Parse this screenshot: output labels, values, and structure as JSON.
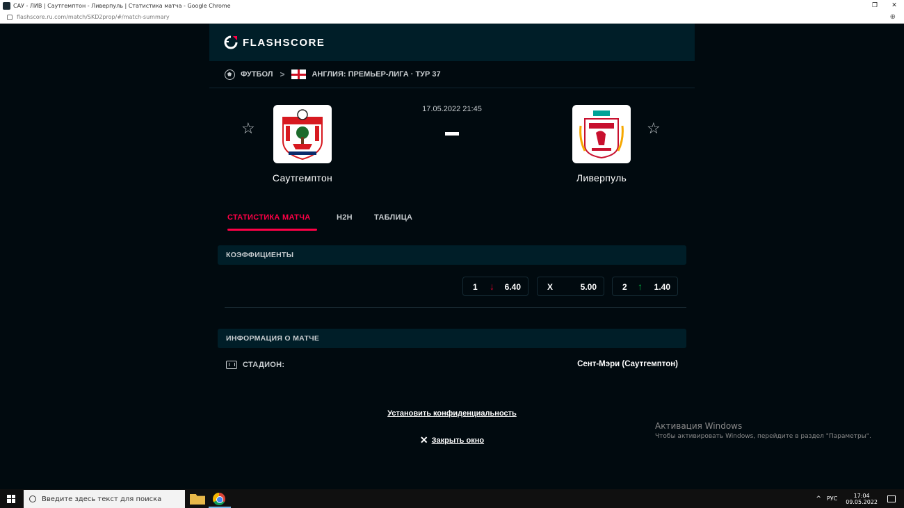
{
  "window": {
    "title": "САУ - ЛИВ | Саутгемптон - Ливерпуль | Статистика матча - Google Chrome",
    "url": "flashscore.ru.com/match/SKD2prop/#/match-summary",
    "zoom_icon": "zoom-icon"
  },
  "header": {
    "logo_text": "FLASHSCORE"
  },
  "breadcrumb": {
    "sport": "ФУТБОЛ",
    "separator": ">",
    "league": "АНГЛИЯ: ПРЕМЬЕР-ЛИГА · ТУР 37"
  },
  "match": {
    "home": {
      "name": "Саутгемптон"
    },
    "away": {
      "name": "Ливерпуль"
    },
    "datetime": "17.05.2022 21:45"
  },
  "tabs": [
    {
      "label": "СТАТИСТИКА МАТЧА",
      "active": true
    },
    {
      "label": "H2H",
      "active": false
    },
    {
      "label": "ТАБЛИЦА",
      "active": false
    }
  ],
  "odds": {
    "heading": "КОЭФФИЦИЕНТЫ",
    "items": [
      {
        "label": "1",
        "value": "6.40",
        "trend": "down"
      },
      {
        "label": "X",
        "value": "5.00",
        "trend": "none"
      },
      {
        "label": "2",
        "value": "1.40",
        "trend": "up"
      }
    ],
    "colors": {
      "down": "#e4002b",
      "up": "#00b140"
    }
  },
  "info": {
    "heading": "ИНФОРМАЦИЯ О МАТЧЕ",
    "stadium_label": "СТАДИОН:",
    "stadium_value": "Сент-Мэри (Саутгемптон)"
  },
  "footer": {
    "privacy": "Установить конфиденциальность",
    "close": "Закрыть окно"
  },
  "watermark": {
    "line1": "Активация Windows",
    "line2": "Чтобы активировать Windows, перейдите в раздел \"Параметры\"."
  },
  "taskbar": {
    "search_placeholder": "Введите здесь текст для поиска",
    "lang": "РУС",
    "time": "17:04",
    "date": "09.05.2022"
  },
  "colors": {
    "accent": "#ff0046",
    "background": "#010a0f",
    "panel": "#001e28"
  }
}
